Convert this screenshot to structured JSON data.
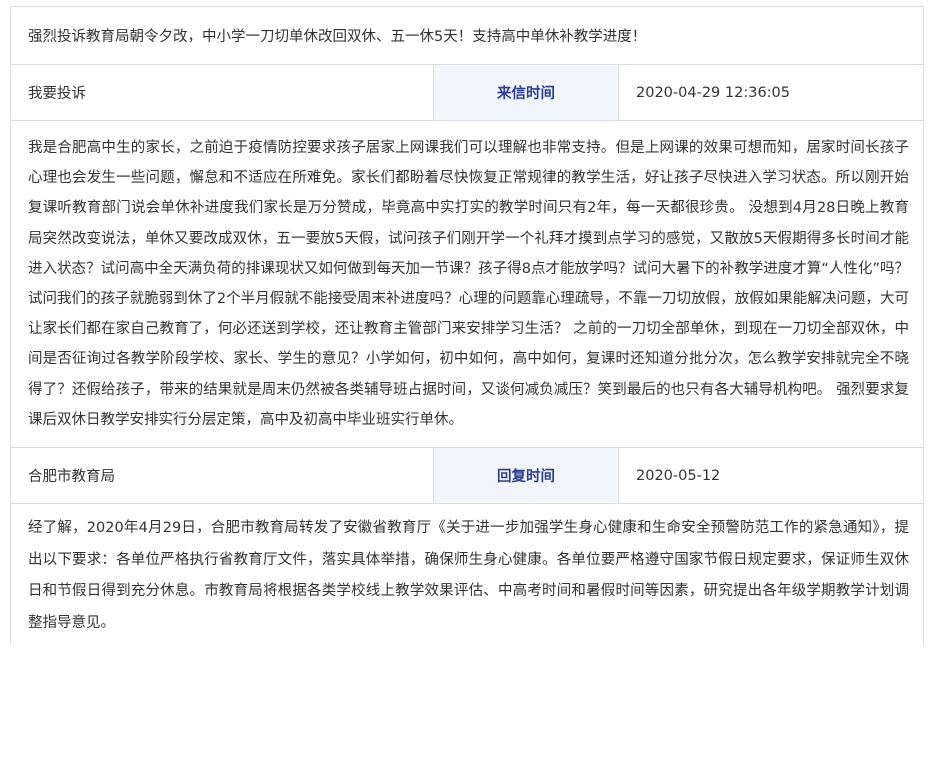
{
  "letter": {
    "title": "强烈投诉教育局朝令夕改，中小学一刀切单休改回双休、五一休5天！支持高中单休补教学进度！",
    "sender": "我要投诉",
    "sent_label": "来信时间",
    "sent_time": "2020-04-29 12:36:05",
    "body": "我是合肥高中生的家长，之前迫于疫情防控要求孩子居家上网课我们可以理解也非常支持。但是上网课的效果可想而知，居家时间长孩子心理也会发生一些问题，懈怠和不适应在所难免。家长们都盼着尽快恢复正常规律的教学生活，好让孩子尽快进入学习状态。所以刚开始复课听教育部门说会单休补进度我们家长是万分赞成，毕竟高中实打实的教学时间只有2年，每一天都很珍贵。 没想到4月28日晚上教育局突然改变说法，单休又要改成双休，五一要放5天假，试问孩子们刚开学一个礼拜才摸到点学习的感觉，又散放5天假期得多长时间才能进入状态？试问高中全天满负荷的排课现状又如何做到每天加一节课？孩子得8点才能放学吗？试问大暑下的补教学进度才算“人性化”吗？试问我们的孩子就脆弱到休了2个半月假就不能接受周末补进度吗？心理的问题靠心理疏导，不靠一刀切放假，放假如果能解决问题，大可让家长们都在家自己教育了，何必还送到学校，还让教育主管部门来安排学习生活？ 之前的一刀切全部单休，到现在一刀切全部双休，中间是否征询过各教学阶段学校、家长、学生的意见？小学如何，初中如何，高中如何，复课时还知道分批分次，怎么教学安排就完全不晓得了？还假给孩子，带来的结果就是周末仍然被各类辅导班占据时间，又谈何减负减压？笑到最后的也只有各大辅导机构吧。 强烈要求复课后双休日教学安排实行分层定策，高中及初高中毕业班实行单休。"
  },
  "reply": {
    "responder": "合肥市教育局",
    "reply_label": "回复时间",
    "reply_time": "2020-05-12",
    "body": "经了解，2020年4月29日，合肥市教育局转发了安徽省教育厅《关于进一步加强学生身心健康和生命安全预警防范工作的紧急通知》，提出以下要求：各单位严格执行省教育厅文件，落实具体举措，确保师生身心健康。各单位要严格遵守国家节假日规定要求，保证师生双休日和节假日得到充分休息。市教育局将根据各类学校线上教学效果评估、中高考时间和暑假时间等因素，研究提出各年级学期教学计划调整指导意见。"
  }
}
